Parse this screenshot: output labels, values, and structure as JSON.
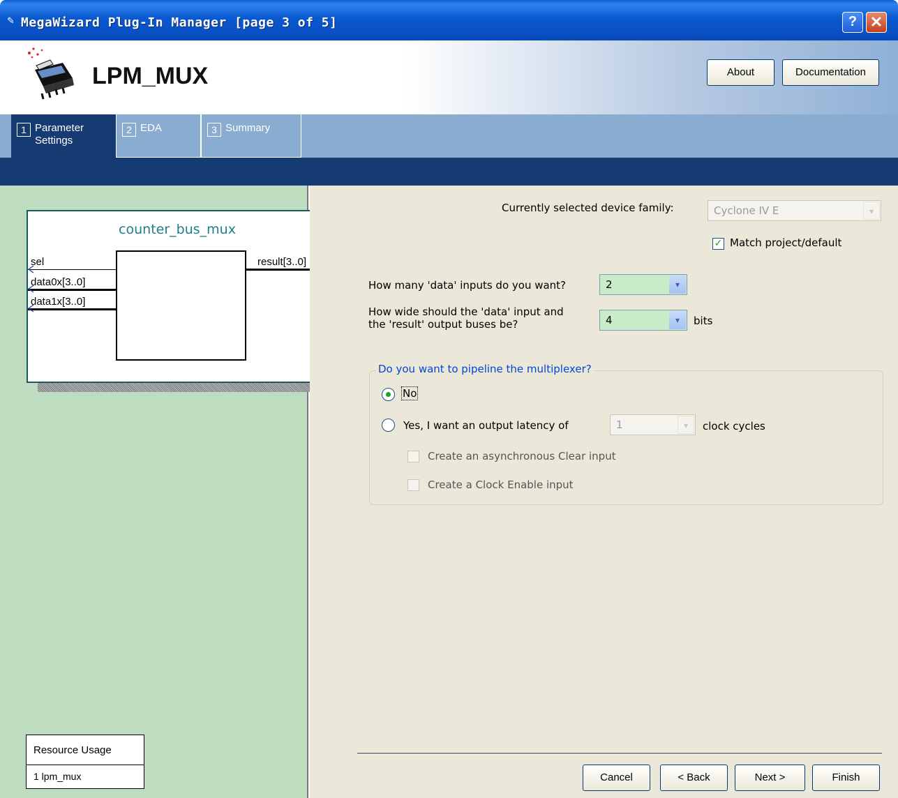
{
  "window": {
    "title": "MegaWizard Plug-In Manager [page 3 of 5]",
    "help_glyph": "?",
    "close_glyph": "✕"
  },
  "header": {
    "app_title": "LPM_MUX",
    "about_label": "About",
    "documentation_label": "Documentation"
  },
  "tabs": [
    {
      "num": "1",
      "label_line1": "Parameter",
      "label_line2": "Settings"
    },
    {
      "num": "2",
      "label_line1": "EDA",
      "label_line2": ""
    },
    {
      "num": "3",
      "label_line1": "Summary",
      "label_line2": ""
    }
  ],
  "symbol": {
    "name": "counter_bus_mux",
    "inputs": [
      "sel",
      "data0x[3..0]",
      "data1x[3..0]"
    ],
    "output": "result[3..0]"
  },
  "resource_usage": {
    "header": "Resource Usage",
    "row": "1 lpm_mux"
  },
  "form": {
    "device_family_label": "Currently selected device family:",
    "device_family_value": "Cyclone IV E",
    "match_default_label": "Match project/default",
    "match_default_checked": true,
    "data_inputs_label": "How many 'data' inputs do you want?",
    "data_inputs_value": "2",
    "width_label_line1": "How wide should the 'data' input and",
    "width_label_line2": "the 'result' output buses be?",
    "width_value": "4",
    "width_unit": "bits",
    "pipeline_group_title": "Do you want to pipeline the multiplexer?",
    "radio_no_label": "No",
    "radio_yes_label": "Yes, I want an output latency of",
    "latency_value": "1",
    "latency_unit": "clock cycles",
    "aclr_label": "Create an asynchronous Clear input",
    "clken_label": "Create a Clock Enable input",
    "selected_option": "No"
  },
  "footer": {
    "cancel_label": "Cancel",
    "back_label": "< Back",
    "next_label": "Next >",
    "finish_label": "Finish"
  },
  "colors": {
    "title_bar": "#0a58d0",
    "tab_band": "#8aacd0",
    "active_tab": "#163a72",
    "left_panel": "#bddcc0",
    "right_panel": "#ebe8d9",
    "symbol_name": "#1e7f86",
    "group_title": "#0046d5"
  }
}
